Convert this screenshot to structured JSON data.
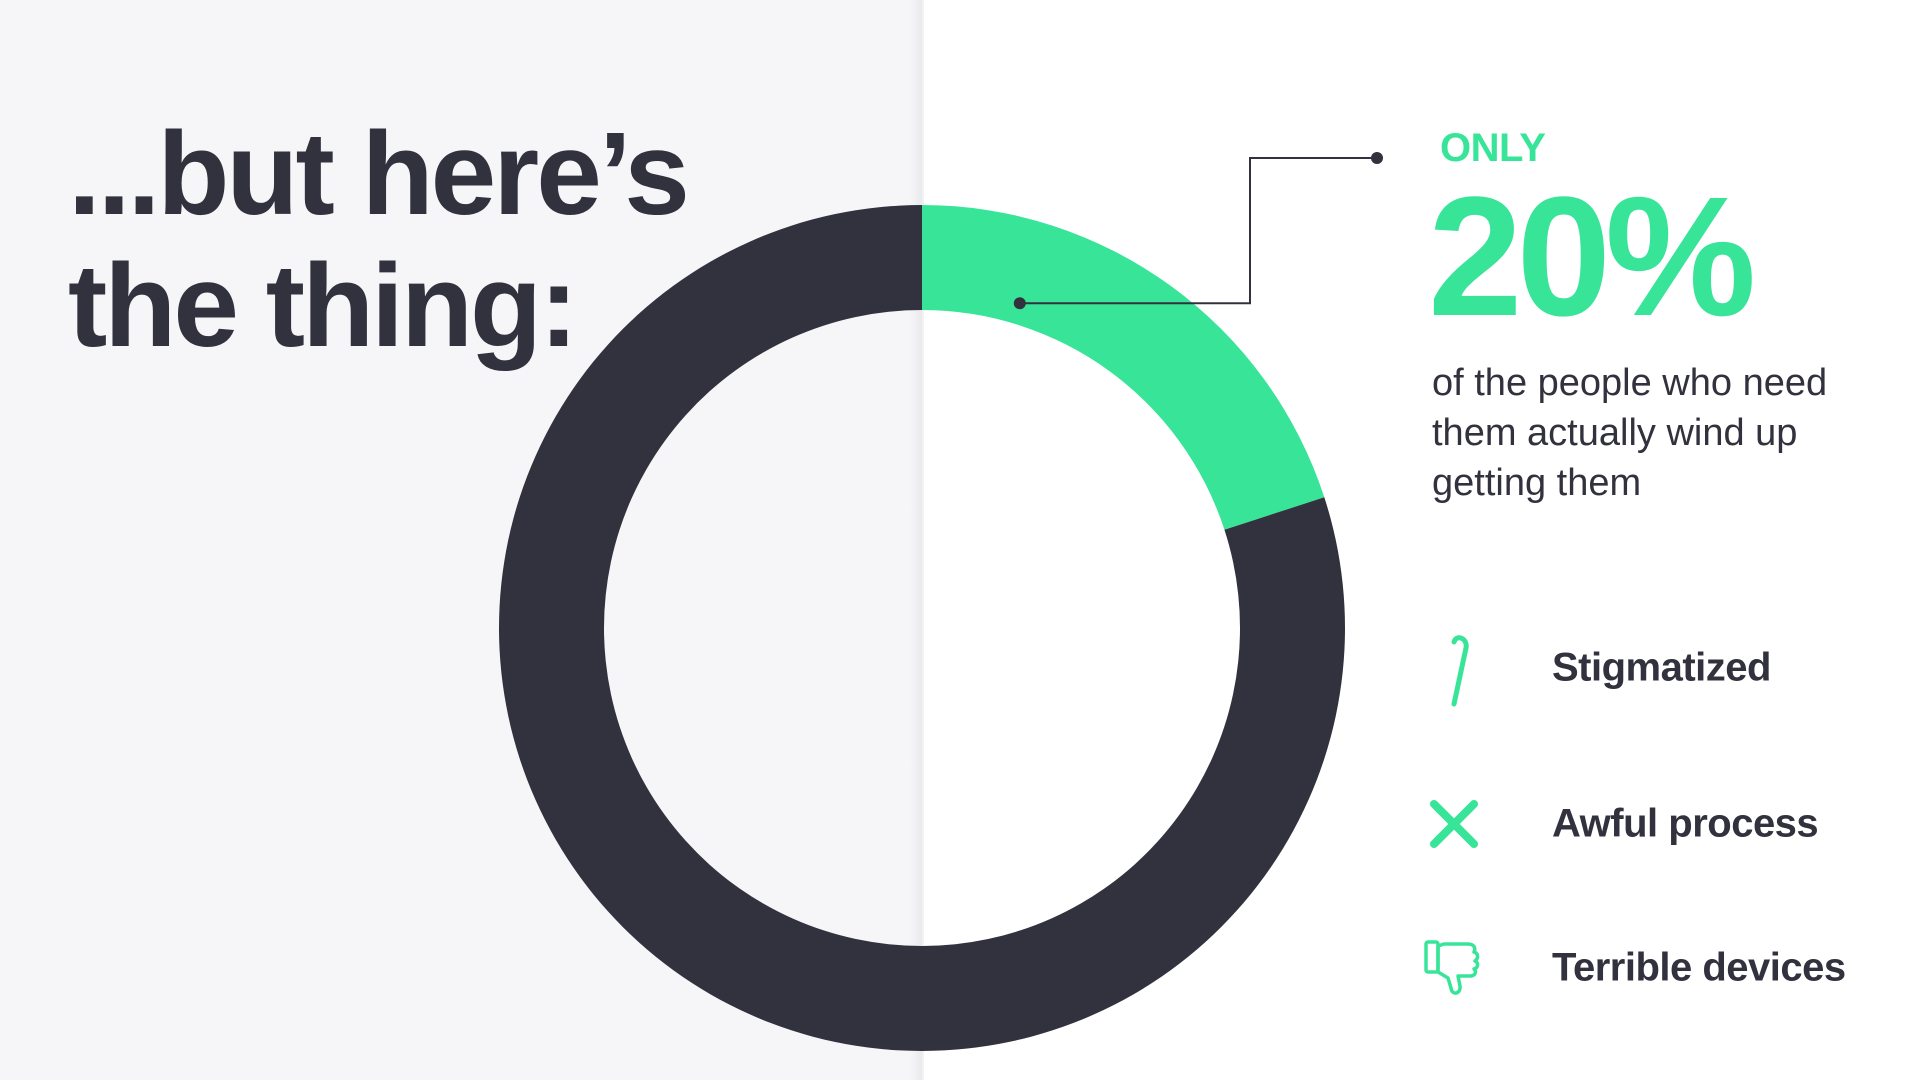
{
  "headline": "...but here’s the thing:",
  "chart_data": {
    "type": "pie",
    "style": "donut",
    "slices": [
      {
        "value": 20,
        "color": "#38e598"
      },
      {
        "value": 80,
        "color": "#32323e"
      }
    ],
    "highlight_slice": 0,
    "start_angle": "12 o'clock",
    "direction": "clockwise",
    "legend": "none"
  },
  "callout": {
    "prefix": "ONLY",
    "value": "20%",
    "description": "of the people who need them actually wind up getting them"
  },
  "reasons": [
    {
      "label": "Stigmatized",
      "icon": "cane-icon"
    },
    {
      "label": "Awful process",
      "icon": "x-icon"
    },
    {
      "label": "Terrible devices",
      "icon": "thumbs-down-icon"
    }
  ],
  "colors": {
    "accent": "#38e598",
    "dark": "#32323e",
    "left_background": "#f6f6f9",
    "right_background": "#ffffff"
  }
}
